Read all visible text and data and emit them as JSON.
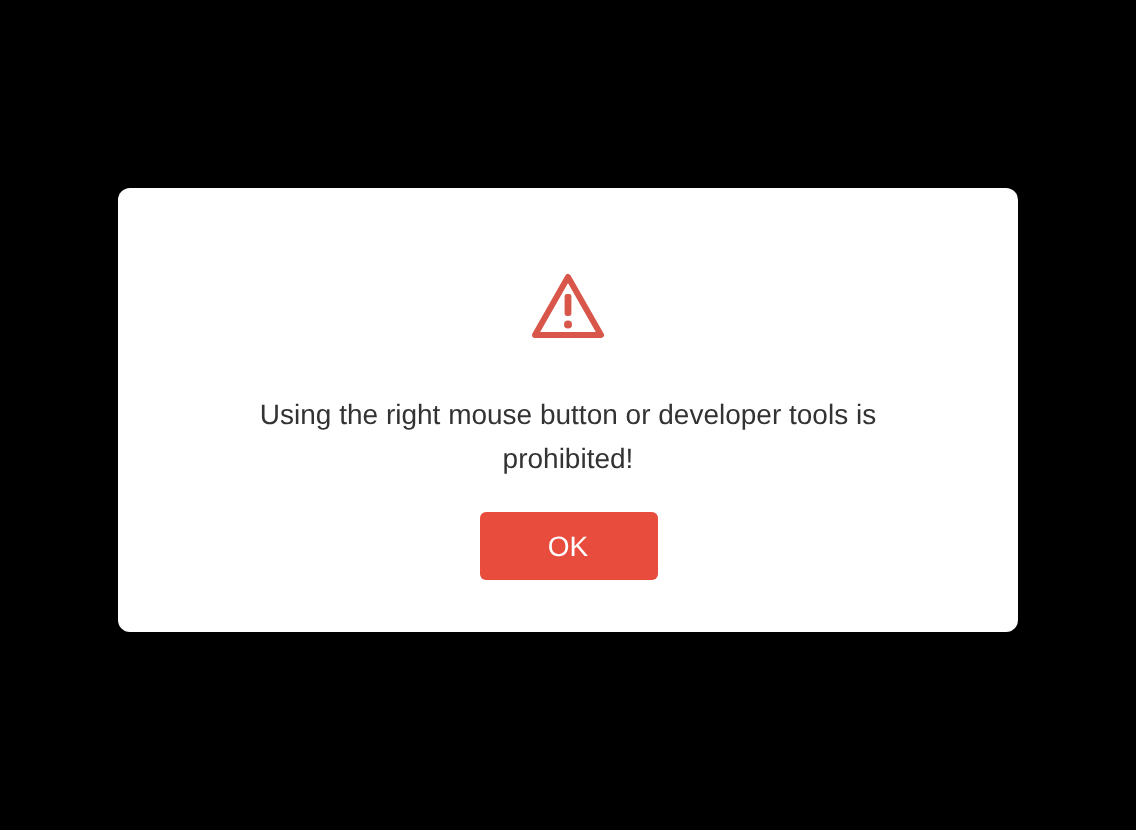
{
  "dialog": {
    "message": "Using the right mouse button or developer tools is prohibited!",
    "buttons": [
      "OK"
    ]
  }
}
